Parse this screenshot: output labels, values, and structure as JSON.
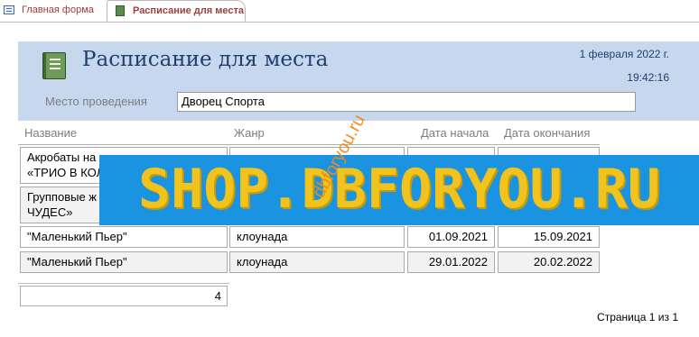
{
  "tabs": [
    {
      "label": "Главная форма",
      "icon": "form-icon",
      "active": false
    },
    {
      "label": "Расписание для места",
      "icon": "report-icon",
      "active": true
    }
  ],
  "report": {
    "title": "Расписание для места",
    "date": "1 февраля 2022 г.",
    "time": "19:42:16",
    "venue_label": "Место проведения",
    "venue_value": "Дворец Спорта"
  },
  "columns": {
    "name": "Название",
    "genre": "Жанр",
    "start": "Дата начала",
    "end": "Дата окончания"
  },
  "rows": [
    {
      "name_line1": "Акробаты на",
      "name_line2": "«ТРИО В КОЛ",
      "genre": "",
      "start": "",
      "end": ""
    },
    {
      "name_line1": "Групповые ж",
      "name_line2": "ЧУДЕС»",
      "genre": "",
      "start": "",
      "end": ""
    },
    {
      "name": "\"Маленький Пьер\"",
      "genre": "клоунада",
      "start": "01.09.2021",
      "end": "15.09.2021"
    },
    {
      "name": "\"Маленький Пьер\"",
      "genre": "клоунада",
      "start": "29.01.2022",
      "end": "20.02.2022"
    }
  ],
  "total": "4",
  "page_label": "Страница 1 из 1",
  "watermark_banner": "SHOP.DBFORYOU.RU",
  "watermark_diagonal": "dbforyou.ru",
  "colors": {
    "header_band": "#c7d7ee",
    "title_text": "#1f3f6d",
    "tab_text": "#a23b3b",
    "banner_bg": "#1a93e0",
    "banner_text": "#f1c31e",
    "watermark": "#f08a1a"
  }
}
